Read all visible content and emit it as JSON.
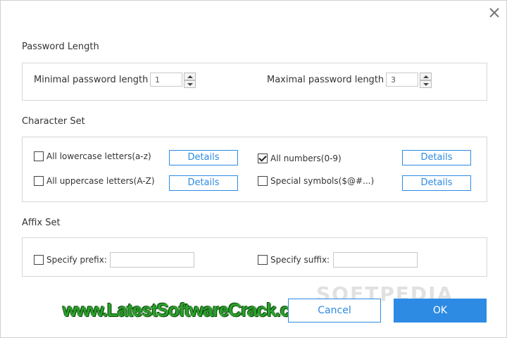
{
  "password_length": {
    "title": "Password Length",
    "min_label": "Minimal password length",
    "min_value": "1",
    "max_label": "Maximal password length",
    "max_value": "3"
  },
  "character_set": {
    "title": "Character Set",
    "lowercase": {
      "label": "All lowercase letters(a-z)",
      "checked": false,
      "details": "Details"
    },
    "uppercase": {
      "label": "All uppercase letters(A-Z)",
      "checked": false,
      "details": "Details"
    },
    "numbers": {
      "label": "All numbers(0-9)",
      "checked": true,
      "details": "Details"
    },
    "symbols": {
      "label": "Special symbols($@#...)",
      "checked": false,
      "details": "Details"
    }
  },
  "affix_set": {
    "title": "Affix Set",
    "prefix_label": "Specify prefix:",
    "prefix_value": "",
    "suffix_label": "Specify suffix:",
    "suffix_value": ""
  },
  "buttons": {
    "cancel": "Cancel",
    "ok": "OK"
  },
  "watermark": "SOFTPEDIA",
  "site_text": "www.LatestSoftwareCrack.com",
  "colors": {
    "accent": "#2d8be3",
    "site_green": "#2ca02c"
  }
}
